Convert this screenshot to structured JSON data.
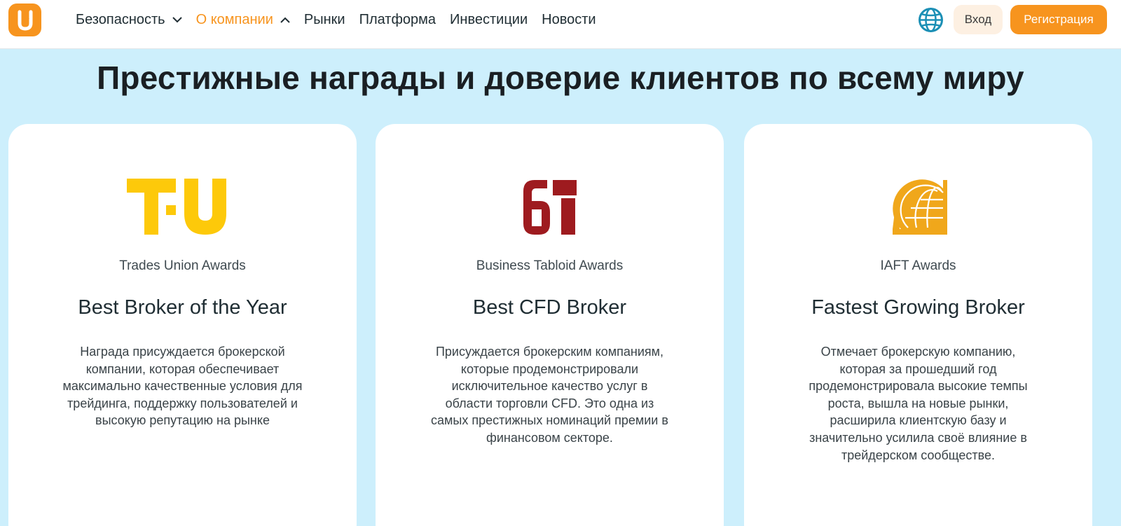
{
  "nav": {
    "items": [
      {
        "label": "Безопасность",
        "chevron": "down",
        "active": false
      },
      {
        "label": "О компании",
        "chevron": "up",
        "active": true
      },
      {
        "label": "Рынки"
      },
      {
        "label": "Платформа"
      },
      {
        "label": "Инвестиции"
      },
      {
        "label": "Новости"
      }
    ],
    "login_label": "Вход",
    "register_label": "Регистрация",
    "language_icon": "globe-icon"
  },
  "headline": "Престижные награды и доверие клиентов по всему миру",
  "cards": [
    {
      "logo_icon": "trades-union-logo",
      "logo_text": "TU",
      "org": "Trades Union Awards",
      "title": "Best Broker of the Year",
      "description": "Награда присуждается брокерской компании, которая обеспечивает максимально качественные условия для трейдинга, поддержку пользователей и высокую репутацию на рынке"
    },
    {
      "logo_icon": "business-tabloid-logo",
      "logo_text": "BT",
      "org": "Business Tabloid Awards",
      "title": "Best CFD Broker",
      "description": "Присуждается брокерским компаниям, которые продемонстрировали исключительное качество услуг в области торговли CFD. Это одна из самых престижных номинаций премии в финансовом секторе."
    },
    {
      "logo_icon": "iaft-globe-logo",
      "org": "IAFT Awards",
      "title": "Fastest Growing Broker",
      "description": "Отмечает брокерскую компанию, которая за прошедший год продемонстрировала высокие темпы роста, вышла на новые рынки, расширила клиентскую базу и значительно усилила своё влияние в трейдерском сообществе."
    }
  ],
  "colors": {
    "accent": "#f7941e",
    "background": "#cdeffc",
    "tu_yellow": "#fdc90a",
    "bt_red": "#9e1b1f",
    "iaft_gold": "#f0a71b",
    "globe_blue": "#1b8fb5"
  }
}
